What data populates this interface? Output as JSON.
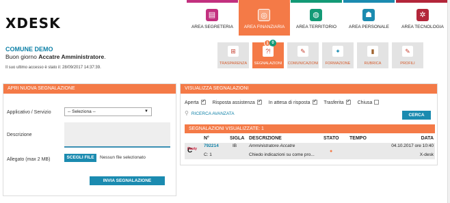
{
  "app": {
    "logo": "XDESK"
  },
  "areas": [
    {
      "label": "AREA SEGRETERIA",
      "color": "#c2307f",
      "icon": "document-icon",
      "glyph": "▤"
    },
    {
      "label": "AREA FINANZIARIA",
      "color": "#f47a47",
      "icon": "coins-icon",
      "glyph": "◎",
      "active": true
    },
    {
      "label": "AREA TERRITORIO",
      "color": "#139a76",
      "icon": "globe-icon",
      "glyph": "◍"
    },
    {
      "label": "AREA PERSONALE",
      "color": "#1b8bb0",
      "icon": "people-icon",
      "glyph": "☗"
    },
    {
      "label": "AREA TECNOLOGIA",
      "color": "#b3263a",
      "icon": "network-icon",
      "glyph": "✲"
    }
  ],
  "info": {
    "comune": "COMUNE DEMO",
    "greeting_prefix": "Buon giorno",
    "user": "Accatre Amministratore",
    "greeting_suffix": ".",
    "last_access": "Il suo ultimo accesso è stato il: 28/09/2017 14:37:39."
  },
  "functions": [
    {
      "label": "TRASPARENZA",
      "icon": "transparency-icon",
      "glyph": "⊞"
    },
    {
      "label": "SEGNALAZIONI",
      "icon": "alert-icon",
      "glyph": "?!",
      "active": true,
      "badges": [
        "1",
        "0"
      ]
    },
    {
      "label": "COMUNICAZIONI",
      "icon": "megaphone-icon",
      "glyph": "✎"
    },
    {
      "label": "FORMAZIONE",
      "icon": "training-icon",
      "glyph": "✦"
    },
    {
      "label": "RUBRICA",
      "icon": "book-icon",
      "glyph": "▮"
    },
    {
      "label": "PROFILI",
      "icon": "profile-icon",
      "glyph": "✎"
    }
  ],
  "new_report": {
    "title": "APRI NUOVA SEGNALAZIONE",
    "app_label": "Applicativo / Servizio",
    "app_value": "-- Seleziona --",
    "desc_label": "Descrizione",
    "attach_label": "Allegato (max 2 MB)",
    "choose_file": "SCEGLI FILE",
    "no_file": "Nessun file selezionato",
    "submit": "INVIA SEGNALAZIONE"
  },
  "view_reports": {
    "title": "VISUALIZZA SEGNALAZIONI",
    "filters": [
      {
        "label": "Aperta",
        "checked": true
      },
      {
        "label": "Risposta assistenza",
        "checked": true
      },
      {
        "label": "In attesa di risposta",
        "checked": true
      },
      {
        "label": "Trasferita",
        "checked": true
      },
      {
        "label": "Chiusa",
        "checked": false
      }
    ],
    "advanced_search": "RICERCA AVANZATA",
    "search_button": "CERCA",
    "list_title": "SEGNALAZIONI VISUALIZZATE: 1",
    "columns": {
      "num": "N°",
      "sigla": "SIGLA",
      "desc": "DESCRIZIONE",
      "stato": "STATO",
      "tempo": "TEMPO",
      "data": "DATA"
    },
    "rows": [
      {
        "num": "792214",
        "sub": "C: 1",
        "sigla": "IB",
        "desc_line1": "Amministratore Accatre",
        "desc_line2": "Chiedo indicazioni su come pro...",
        "date": "04.10.2017 ore 10:40",
        "product": "X-desk",
        "brand": "Cauty"
      }
    ]
  }
}
